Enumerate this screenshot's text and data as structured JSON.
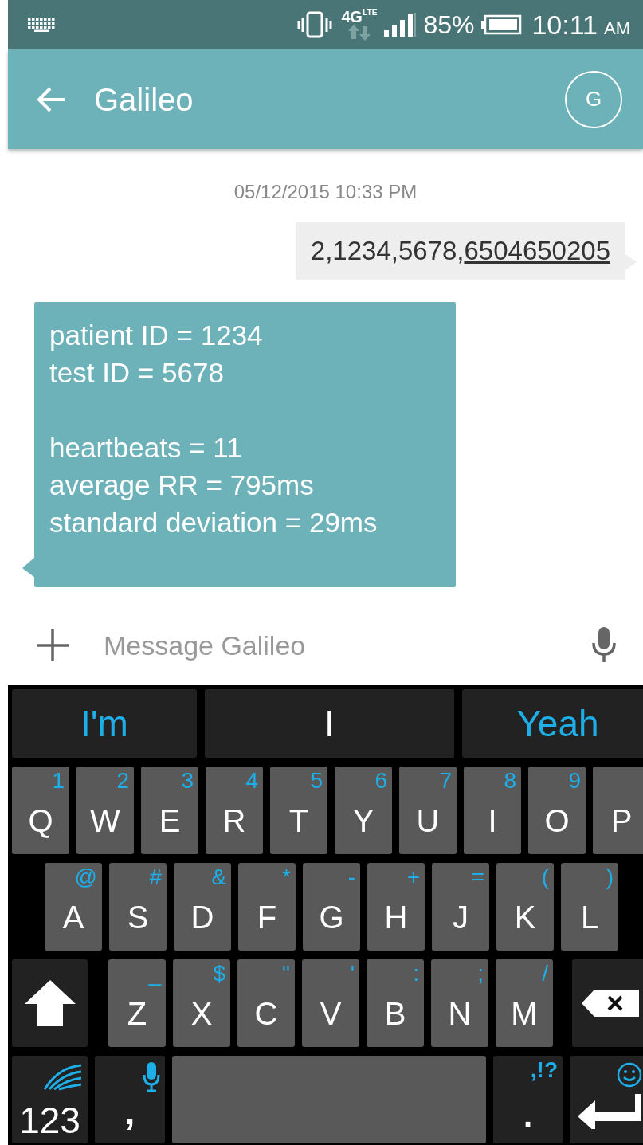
{
  "status_bar": {
    "network": "4G",
    "network_sub": "LTE",
    "battery": "85%",
    "time": "10:11",
    "time_suffix": "AM"
  },
  "app_bar": {
    "title": "Galileo",
    "avatar": "G"
  },
  "messages": [
    {
      "kind": "timestamp",
      "text": "05/12/2015 10:33 PM"
    },
    {
      "kind": "outgoing",
      "text": "2,1234,5678,",
      "link": "6504650205"
    },
    {
      "kind": "incoming",
      "paragraphs": [
        [
          "patient ID = 1234",
          "test ID = 5678"
        ],
        [
          "heartbeats = 11",
          "average RR = 795ms",
          "standard deviation = 29ms"
        ]
      ]
    }
  ],
  "compose": {
    "placeholder": "Message Galileo"
  },
  "suggestions": [
    {
      "text": "I'm",
      "selected": false
    },
    {
      "text": "I",
      "selected": true
    },
    {
      "text": "Yeah",
      "selected": false
    }
  ],
  "keyboard": {
    "symbols_key": {
      "label": "123"
    },
    "comma_key": {
      "label": ","
    },
    "period_key": {
      "label": ".",
      "hint": ",!?"
    },
    "letter_rows": [
      [
        {
          "kind": "letter",
          "label": "Q",
          "hint": "1"
        },
        {
          "kind": "letter",
          "label": "W",
          "hint": "2"
        },
        {
          "kind": "letter",
          "label": "E",
          "hint": "3"
        },
        {
          "kind": "letter",
          "label": "R",
          "hint": "4"
        },
        {
          "kind": "letter",
          "label": "T",
          "hint": "5"
        },
        {
          "kind": "letter",
          "label": "Y",
          "hint": "6"
        },
        {
          "kind": "letter",
          "label": "U",
          "hint": "7"
        },
        {
          "kind": "letter",
          "label": "I",
          "hint": "8"
        },
        {
          "kind": "letter",
          "label": "O",
          "hint": "9"
        },
        {
          "kind": "letter",
          "label": "P"
        }
      ],
      [
        {
          "kind": "letter",
          "label": "A",
          "hint": "@"
        },
        {
          "kind": "letter",
          "label": "S",
          "hint": "#"
        },
        {
          "kind": "letter",
          "label": "D",
          "hint": "&"
        },
        {
          "kind": "letter",
          "label": "F",
          "hint": "*"
        },
        {
          "kind": "letter",
          "label": "G",
          "hint": "-"
        },
        {
          "kind": "letter",
          "label": "H",
          "hint": "+"
        },
        {
          "kind": "letter",
          "label": "J",
          "hint": "="
        },
        {
          "kind": "letter",
          "label": "K",
          "hint": "("
        },
        {
          "kind": "letter",
          "label": "L",
          "hint": ")"
        }
      ],
      [
        {
          "kind": "letter",
          "label": "Z",
          "hint": "_"
        },
        {
          "kind": "letter",
          "label": "X",
          "hint": "$"
        },
        {
          "kind": "letter",
          "label": "C",
          "hint": "\""
        },
        {
          "kind": "letter",
          "label": "V",
          "hint": "'"
        },
        {
          "kind": "letter",
          "label": "B",
          "hint": ":"
        },
        {
          "kind": "letter",
          "label": "N",
          "hint": ";"
        },
        {
          "kind": "letter",
          "label": "M",
          "hint": "/"
        }
      ]
    ]
  }
}
